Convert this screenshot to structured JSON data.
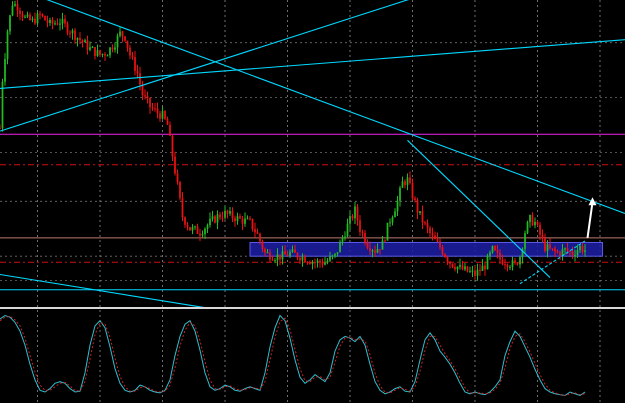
{
  "colors": {
    "background": "#000000",
    "grid": "#8a8a8a",
    "bull": "#22bb22",
    "bear": "#ee1111",
    "trendline": "#00d8ff",
    "magenta_level": "#ee22ee",
    "red_dash_level": "#cc1111",
    "zone_fill": "#1e1ea8",
    "zone_edge": "#5a5ae8",
    "separator": "#d8d8d8",
    "oscillator_main": "#2fbfcf",
    "oscillator_signal": "#cc2222",
    "arrow": "#ffffff"
  },
  "chart_data": [
    {
      "type": "candlestick",
      "panel": "price",
      "ylim": [
        0,
        100
      ],
      "xlim": [
        0,
        250
      ],
      "grid": true,
      "grid_x": [
        15,
        40,
        65,
        90,
        115,
        140,
        165,
        190,
        215,
        240
      ],
      "grid_y": [
        8,
        16,
        34,
        50,
        68,
        86
      ],
      "candles": [],
      "anchors": [
        [
          0,
          58
        ],
        [
          1,
          74
        ],
        [
          3,
          90
        ],
        [
          5,
          99
        ],
        [
          7,
          98
        ],
        [
          10,
          94
        ],
        [
          13,
          93
        ],
        [
          16,
          95
        ],
        [
          20,
          92
        ],
        [
          24,
          93
        ],
        [
          28,
          90
        ],
        [
          32,
          87
        ],
        [
          36,
          84
        ],
        [
          40,
          82
        ],
        [
          43,
          83
        ],
        [
          46,
          86
        ],
        [
          48,
          89
        ],
        [
          50,
          88
        ],
        [
          52,
          82
        ],
        [
          55,
          76
        ],
        [
          57,
          69
        ],
        [
          60,
          65
        ],
        [
          63,
          63
        ],
        [
          65,
          62
        ],
        [
          67,
          59
        ],
        [
          70,
          44
        ],
        [
          73,
          29
        ],
        [
          76,
          25
        ],
        [
          80,
          24
        ],
        [
          84,
          27
        ],
        [
          87,
          29
        ],
        [
          90,
          30
        ],
        [
          93,
          29
        ],
        [
          96,
          28
        ],
        [
          100,
          27
        ],
        [
          103,
          23
        ],
        [
          106,
          17
        ],
        [
          110,
          16
        ],
        [
          113,
          16
        ],
        [
          116,
          17
        ],
        [
          120,
          16
        ],
        [
          123,
          15
        ],
        [
          126,
          14
        ],
        [
          130,
          14
        ],
        [
          134,
          16
        ],
        [
          137,
          22
        ],
        [
          139,
          26
        ],
        [
          142,
          31
        ],
        [
          144,
          25
        ],
        [
          147,
          20
        ],
        [
          150,
          18
        ],
        [
          153,
          20
        ],
        [
          156,
          28
        ],
        [
          159,
          34
        ],
        [
          161,
          40
        ],
        [
          163,
          41
        ],
        [
          165,
          36
        ],
        [
          167,
          31
        ],
        [
          170,
          26
        ],
        [
          173,
          22
        ],
        [
          176,
          19
        ],
        [
          180,
          14
        ],
        [
          184,
          12
        ],
        [
          187,
          11
        ],
        [
          190,
          10
        ],
        [
          194,
          13
        ],
        [
          197,
          18
        ],
        [
          200,
          15
        ],
        [
          203,
          14
        ],
        [
          206,
          13
        ],
        [
          208,
          16
        ],
        [
          210,
          24
        ],
        [
          212,
          28
        ],
        [
          214,
          27
        ],
        [
          216,
          23
        ],
        [
          218,
          19
        ],
        [
          220,
          18
        ],
        [
          223,
          17
        ],
        [
          226,
          18
        ],
        [
          229,
          17
        ],
        [
          232,
          19
        ],
        [
          234,
          18
        ]
      ],
      "levels": {
        "magenta": 56,
        "red_dash_upper": 46,
        "red_dash_lower": 14,
        "brown_solid": 22,
        "cyan_horizontal": 5
      },
      "zone": {
        "x_start": 100,
        "x_end": 241,
        "y_low": 16,
        "y_high": 20.5
      },
      "trendlines": [
        {
          "from": [
            6,
            104
          ],
          "to": [
            250,
            30
          ]
        },
        {
          "from": [
            0,
            57
          ],
          "to": [
            178,
            104
          ]
        },
        {
          "from": [
            0,
            71
          ],
          "to": [
            250,
            87
          ]
        },
        {
          "from": [
            0,
            10
          ],
          "to": [
            83,
            -1
          ]
        },
        {
          "from": [
            163,
            54
          ],
          "to": [
            220,
            9
          ]
        },
        {
          "from": [
            208,
            7
          ],
          "to": [
            234,
            21
          ]
        }
      ],
      "arrow": {
        "from": [
          235,
          22
        ],
        "to": [
          237,
          35
        ]
      }
    },
    {
      "type": "line",
      "panel": "oscillator",
      "ylim": [
        0,
        100
      ],
      "xlim": [
        0,
        250
      ],
      "series": [
        {
          "role": "main",
          "x": [
            0,
            2,
            4,
            6,
            8,
            10,
            12,
            14,
            16,
            18,
            20,
            22,
            24,
            26,
            28,
            30,
            32,
            34,
            36,
            38,
            40,
            42,
            44,
            46,
            48,
            50,
            52,
            54,
            56,
            58,
            60,
            62,
            64,
            66,
            68,
            70,
            72,
            74,
            76,
            78,
            80,
            82,
            84,
            86,
            88,
            90,
            92,
            94,
            96,
            98,
            100,
            102,
            104,
            106,
            108,
            110,
            112,
            114,
            116,
            118,
            120,
            122,
            124,
            126,
            128,
            130,
            132,
            134,
            136,
            138,
            140,
            142,
            144,
            146,
            148,
            150,
            152,
            154,
            156,
            158,
            160,
            162,
            164,
            166,
            168,
            170,
            172,
            174,
            176,
            178,
            180,
            182,
            184,
            186,
            188,
            190,
            192,
            194,
            196,
            198,
            200,
            202,
            204,
            206,
            208,
            210,
            212,
            214,
            216,
            218,
            220,
            222,
            224,
            226,
            228,
            230,
            232,
            234
          ],
          "values": [
            92,
            96,
            94,
            88,
            78,
            62,
            40,
            22,
            10,
            8,
            12,
            18,
            20,
            18,
            12,
            8,
            9,
            30,
            62,
            84,
            90,
            82,
            60,
            35,
            18,
            10,
            8,
            10,
            16,
            14,
            10,
            8,
            7,
            10,
            22,
            50,
            72,
            86,
            90,
            78,
            56,
            30,
            14,
            10,
            12,
            16,
            14,
            10,
            9,
            12,
            14,
            12,
            10,
            30,
            60,
            82,
            96,
            90,
            70,
            45,
            25,
            18,
            22,
            28,
            24,
            20,
            30,
            55,
            68,
            72,
            70,
            66,
            72,
            62,
            40,
            20,
            10,
            6,
            8,
            12,
            14,
            9,
            8,
            20,
            45,
            68,
            76,
            68,
            55,
            48,
            40,
            30,
            18,
            8,
            6,
            8,
            6,
            5,
            8,
            14,
            22,
            50,
            66,
            78,
            72,
            60,
            48,
            34,
            22,
            12,
            8,
            6,
            5,
            4,
            8,
            6,
            4,
            8
          ]
        },
        {
          "role": "signal",
          "x": [
            0,
            2,
            4,
            6,
            8,
            10,
            12,
            14,
            16,
            18,
            20,
            22,
            24,
            26,
            28,
            30,
            32,
            34,
            36,
            38,
            40,
            42,
            44,
            46,
            48,
            50,
            52,
            54,
            56,
            58,
            60,
            62,
            64,
            66,
            68,
            70,
            72,
            74,
            76,
            78,
            80,
            82,
            84,
            86,
            88,
            90,
            92,
            94,
            96,
            98,
            100,
            102,
            104,
            106,
            108,
            110,
            112,
            114,
            116,
            118,
            120,
            122,
            124,
            126,
            128,
            130,
            132,
            134,
            136,
            138,
            140,
            142,
            144,
            146,
            148,
            150,
            152,
            154,
            156,
            158,
            160,
            162,
            164,
            166,
            168,
            170,
            172,
            174,
            176,
            178,
            180,
            182,
            184,
            186,
            188,
            190,
            192,
            194,
            196,
            198,
            200,
            202,
            204,
            206,
            208,
            210,
            212,
            214,
            216,
            218,
            220,
            222,
            224,
            226,
            228,
            230,
            232,
            234
          ],
          "values": [
            90,
            94,
            95,
            91,
            84,
            70,
            50,
            31,
            16,
            10,
            10,
            14,
            18,
            19,
            15,
            10,
            9,
            20,
            46,
            74,
            88,
            86,
            71,
            47,
            26,
            14,
            9,
            9,
            13,
            14,
            12,
            9,
            8,
            9,
            16,
            36,
            61,
            79,
            88,
            84,
            67,
            43,
            22,
            12,
            11,
            14,
            15,
            12,
            10,
            11,
            13,
            13,
            11,
            20,
            45,
            71,
            89,
            93,
            80,
            57,
            35,
            21,
            20,
            25,
            26,
            22,
            25,
            42,
            61,
            70,
            71,
            68,
            69,
            67,
            51,
            30,
            15,
            8,
            7,
            10,
            13,
            11,
            9,
            14,
            32,
            56,
            72,
            72,
            62,
            52,
            44,
            35,
            24,
            13,
            7,
            7,
            7,
            6,
            7,
            11,
            18,
            36,
            58,
            72,
            75,
            66,
            54,
            41,
            28,
            17,
            10,
            7,
            5,
            4,
            6,
            7,
            5,
            6
          ]
        }
      ]
    }
  ]
}
